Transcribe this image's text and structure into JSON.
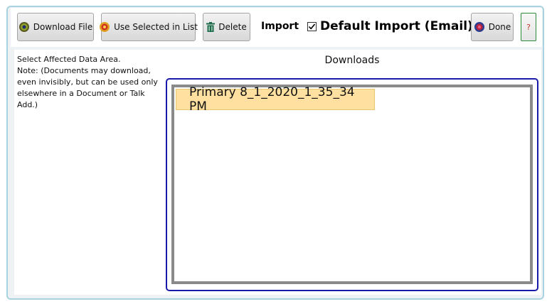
{
  "toolbar": {
    "download_file_label": "Download File",
    "use_selected_label": "Use Selected in List",
    "delete_label": "Delete",
    "import_label": "Import",
    "default_import_label": "Default Import (Email)",
    "default_import_checked": true,
    "done_label": "Done",
    "help_label": "?"
  },
  "note": {
    "line1": "Select Affected Data Area.",
    "line2": "Note: (Documents may download, even invisibly, but can be used only elsewhere in a Document or Talk Add.)"
  },
  "downloads": {
    "title": "Downloads",
    "items": [
      {
        "label": "Primary 8_1_2020_1_35_34 PM",
        "selected": true
      }
    ]
  },
  "colors": {
    "frame_border": "#a9d3e0",
    "list_border": "#1a1aaa",
    "selected_item": "#ffe0a0",
    "help_border": "#2e8b3d"
  },
  "icons": {
    "download_file": "download-disc-icon",
    "use_selected": "use-selected-disc-icon",
    "delete": "trash-icon",
    "done": "done-disc-icon",
    "checkbox": "checkmark-icon"
  }
}
